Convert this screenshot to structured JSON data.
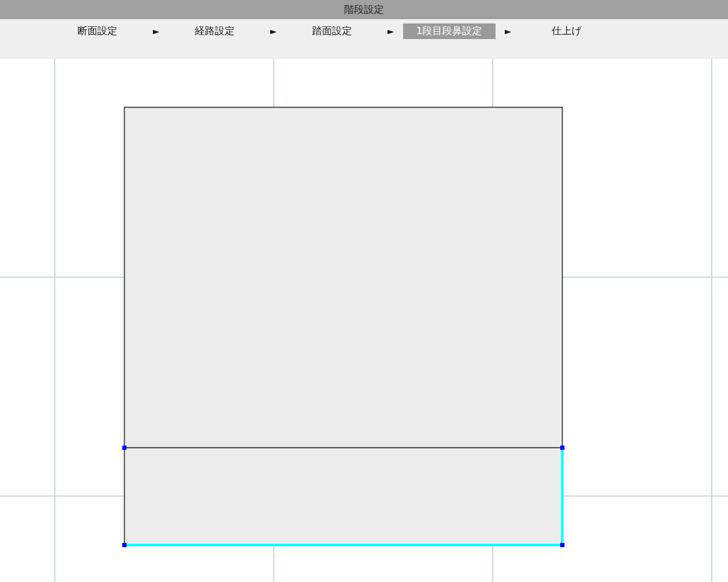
{
  "window": {
    "title": "階段設定"
  },
  "steps": [
    {
      "label": "断面設定",
      "selected": false,
      "arrow": "►"
    },
    {
      "label": "経路設定",
      "selected": false,
      "arrow": "►"
    },
    {
      "label": "踏面設定",
      "selected": false,
      "arrow": "►"
    },
    {
      "label": "1段目段鼻設定",
      "selected": true,
      "arrow": "►"
    },
    {
      "label": "仕上げ",
      "selected": false
    }
  ]
}
